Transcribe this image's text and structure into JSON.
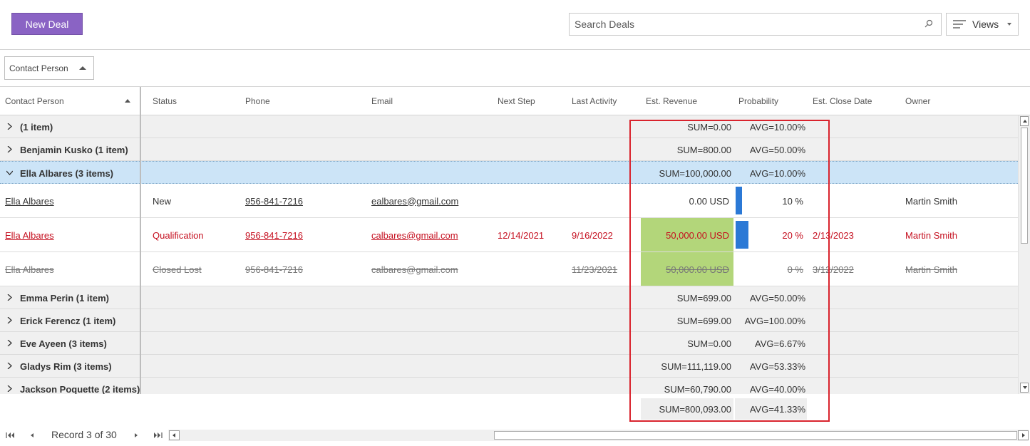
{
  "toolbar": {
    "new_deal_label": "New Deal",
    "search_placeholder": "Search Deals",
    "views_label": "Views"
  },
  "group_panel": {
    "chip_label": "Contact Person"
  },
  "columns": {
    "contact_person": "Contact Person",
    "status": "Status",
    "phone": "Phone",
    "email": "Email",
    "next_step": "Next Step",
    "last_activity": "Last Activity",
    "est_revenue": "Est. Revenue",
    "probability": "Probability",
    "est_close_date": "Est. Close Date",
    "owner": "Owner"
  },
  "groups": [
    {
      "title": "(1 item)",
      "sum": "SUM=0.00",
      "avg": "AVG=10.00%"
    },
    {
      "title": "Benjamin Kusko (1 item)",
      "sum": "SUM=800.00",
      "avg": "AVG=50.00%"
    },
    {
      "title": "Ella Albares (3 items)",
      "sum": "SUM=100,000.00",
      "avg": "AVG=10.00%"
    },
    {
      "title": "Emma Perin (1 item)",
      "sum": "SUM=699.00",
      "avg": "AVG=50.00%"
    },
    {
      "title": "Erick Ferencz (1 item)",
      "sum": "SUM=699.00",
      "avg": "AVG=100.00%"
    },
    {
      "title": "Eve Ayeen (3 items)",
      "sum": "SUM=0.00",
      "avg": "AVG=6.67%"
    },
    {
      "title": "Gladys Rim (3 items)",
      "sum": "SUM=111,119.00",
      "avg": "AVG=53.33%"
    },
    {
      "title": "Jackson Poquette (2 items)",
      "sum": "SUM=60,790.00",
      "avg": "AVG=40.00%"
    }
  ],
  "rows": [
    {
      "contact": "Ella Albares",
      "status": "New",
      "phone": "956-841-7216",
      "email": "ealbares@gmail.com",
      "next_step": "",
      "last_activity": "",
      "revenue": "0.00 USD",
      "probability": "10 %",
      "probability_value": 10,
      "close_date": "",
      "owner": "Martin Smith"
    },
    {
      "contact": "Ella Albares",
      "status": "Qualification",
      "phone": "956-841-7216",
      "email": "calbares@gmail.com",
      "next_step": "12/14/2021",
      "last_activity": "9/16/2022",
      "revenue": "50,000.00 USD",
      "probability": "20 %",
      "probability_value": 20,
      "close_date": "2/13/2023",
      "owner": "Martin Smith"
    },
    {
      "contact": "Ella Albares",
      "status": "Closed Lost",
      "phone": "956-841-7216",
      "email": "calbares@gmail.com",
      "next_step": "",
      "last_activity": "11/23/2021",
      "revenue": "50,000.00 USD",
      "probability": "0 %",
      "probability_value": 0,
      "close_date": "3/12/2022",
      "owner": "Martin Smith"
    }
  ],
  "totals": {
    "sum": "SUM=800,093.00",
    "avg": "AVG=41.33%"
  },
  "pager": {
    "record_info": "Record 3 of 30"
  },
  "colors": {
    "accent": "#8a63c4",
    "selected_group": "#cce4f7",
    "revenue_highlight": "#b3d67a",
    "probability_bar": "#2b79d6",
    "warning_red": "#c50f1f",
    "callout_border": "#d9232d"
  },
  "icons": {
    "search": "search-icon",
    "views": "menu-lines-icon",
    "expand": "chevron-right-icon",
    "collapse": "chevron-down-icon"
  }
}
